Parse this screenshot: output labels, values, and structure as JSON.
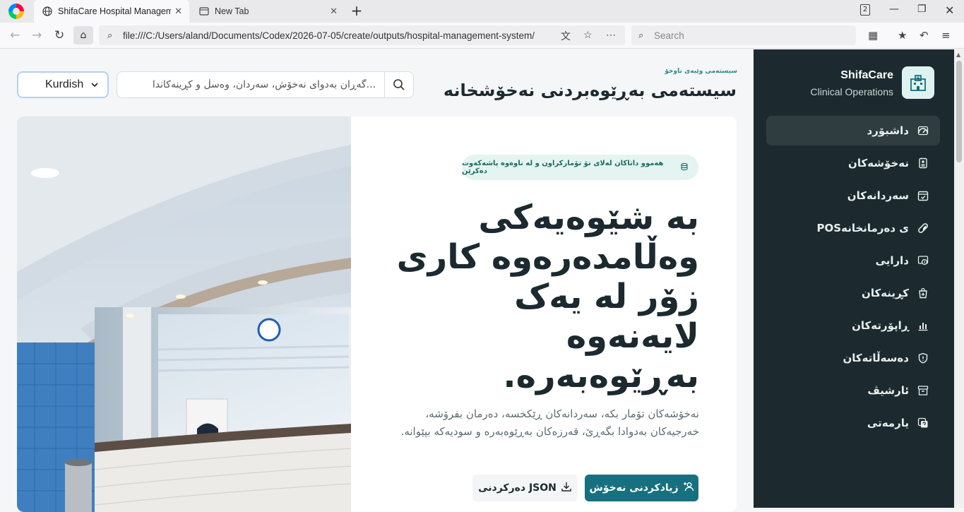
{
  "browser": {
    "tabs": [
      {
        "title": "ShifaCare Hospital Managem",
        "close": "✕"
      },
      {
        "title": "New Tab",
        "close": "✕"
      }
    ],
    "new_tab": "+",
    "url": "file:///C:/Users/aland/Documents/Codex/2026-07-05/create/outputs/hospital-management-system/",
    "search_placeholder": "Search",
    "tab_count": "2"
  },
  "header": {
    "eyebrow": "سیستەمی وێبەی ناوخۆ",
    "title": "سیستەمی بەڕێوەبردنی نەخۆشخانە",
    "search_placeholder": "گەڕان بەدوای نەخۆش، سەردان، وەسڵ و کڕینەکاندا...",
    "language": "Kurdish"
  },
  "brand": {
    "name": "ShifaCare",
    "subtitle": "Clinical Operations"
  },
  "sidebar": {
    "items": [
      {
        "label": "داشبۆرد",
        "icon": "dashboard-icon"
      },
      {
        "label": "نەخۆشەکان",
        "icon": "patients-icon"
      },
      {
        "label": "سەردانەکان",
        "icon": "calendar-icon"
      },
      {
        "label": "POSی دەرمانخانە",
        "icon": "pill-icon"
      },
      {
        "label": "دارایی",
        "icon": "finance-icon"
      },
      {
        "label": "کڕینەکان",
        "icon": "purchase-icon"
      },
      {
        "label": "ڕاپۆرتەکان",
        "icon": "reports-icon"
      },
      {
        "label": "دەسەڵاتەکان",
        "icon": "shield-icon"
      },
      {
        "label": "ئارشیڤ",
        "icon": "archive-icon"
      },
      {
        "label": "یارمەتی",
        "icon": "help-icon"
      }
    ]
  },
  "hero": {
    "pill": "هەموو داتاکان لەلای تۆ تۆمارکراون و لە ناوەوە پاشەکەوت دەکرێن",
    "headline": "بە شێوەیەکی وەڵامدەرەوە کاری زۆر لە یەک لایەنەوە بەڕێوەبەرە.",
    "lead": "نەخۆشەکان تۆمار بکە، سەردانەکان ڕێکخسە، دەرمان بفرۆشە، خەرجیەکان بەدوادا بگەڕێ، قەرزەکان بەڕێوەبەرە و سودیەکە بپێوانە.",
    "primary_button": "زیادکردنی نەخۆش",
    "secondary_button": "دەرکردنی JSON"
  },
  "colors": {
    "sidebar_bg": "#1c2a2f",
    "accent": "#17707f",
    "pill_bg": "#e3f4f1"
  }
}
